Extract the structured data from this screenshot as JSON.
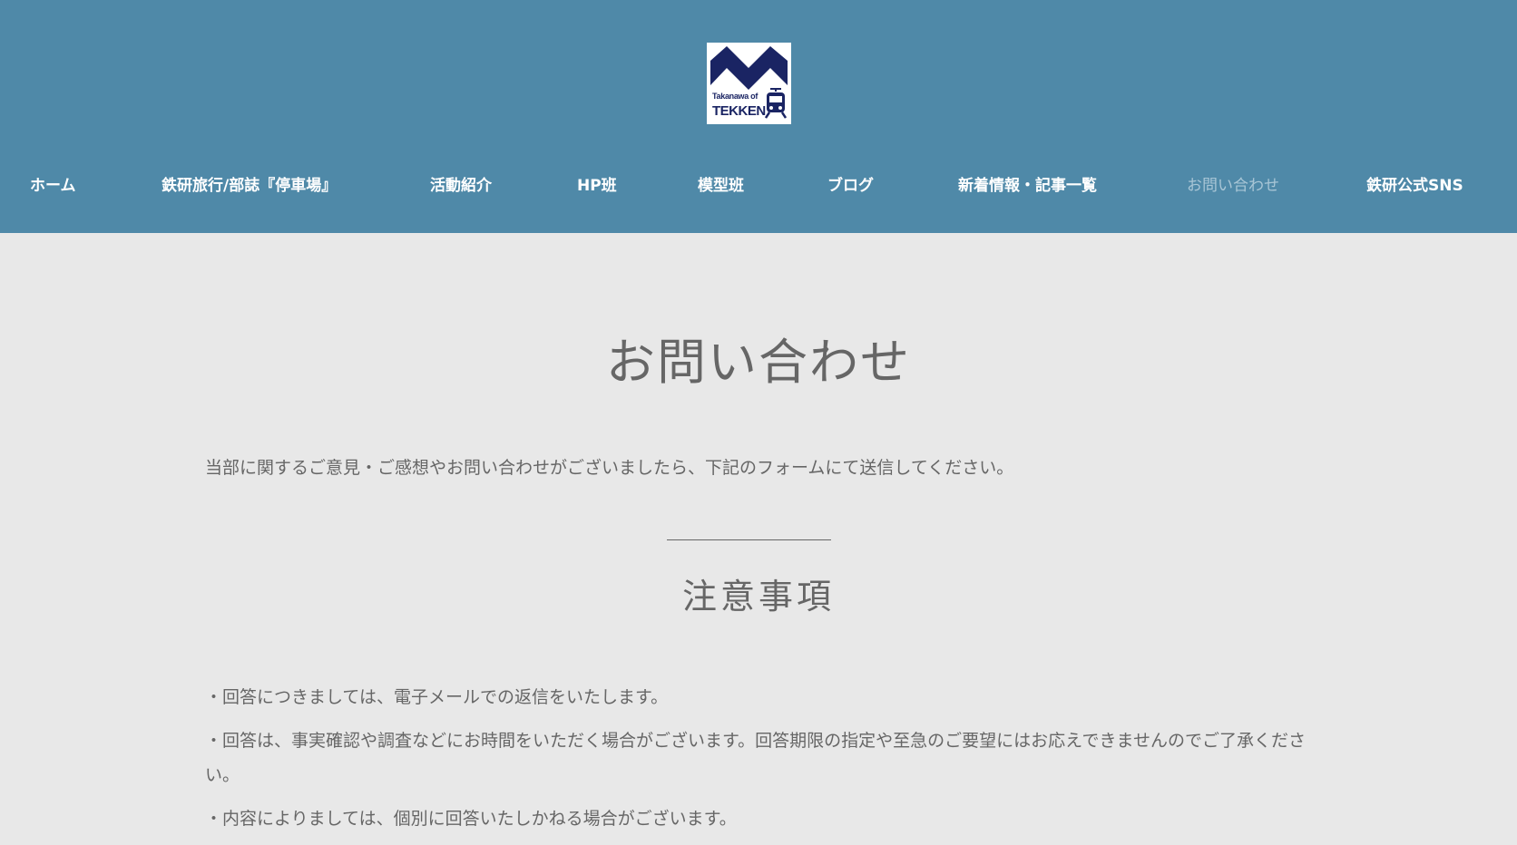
{
  "header": {
    "logo": {
      "line1": "Takanawa of",
      "line2": "TEKKEN",
      "icon": "train-icon",
      "colors": {
        "navy": "#1a2463",
        "background": "#ffffff"
      }
    },
    "background_color": "#4f89a8"
  },
  "nav": {
    "items": [
      {
        "label": "ホーム"
      },
      {
        "label": "鉄研旅行/部誌『停車場』"
      },
      {
        "label": "活動紹介"
      },
      {
        "label": "HP班"
      },
      {
        "label": "模型班"
      },
      {
        "label": "ブログ"
      },
      {
        "label": "新着情報・記事一覧"
      },
      {
        "label": "お問い合わせ",
        "active": true
      },
      {
        "label": "鉄研公式SNS"
      }
    ]
  },
  "main": {
    "title": "お問い合わせ",
    "intro": "当部に関するご意見・ご感想やお問い合わせがございましたら、下記のフォームにて送信してください。",
    "notice_heading": "注意事項",
    "notes": [
      "・回答につきましては、電子メールでの返信をいたします。",
      "・回答は、事実確認や調査などにお時間をいただく場合がございます。回答期限の指定や至急のご要望にはお応えできませんのでご了承ください。",
      "・内容によりましては、個別に回答いたしかねる場合がございます。"
    ],
    "text_color": "#666666",
    "page_background": "#e8e8e8"
  }
}
